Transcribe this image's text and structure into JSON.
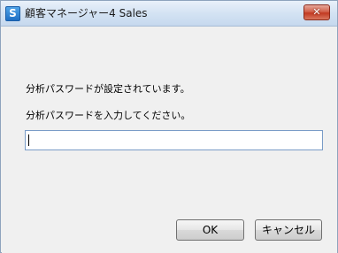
{
  "window": {
    "title": "顧客マネージャー4 Sales",
    "app_icon": "S",
    "close_icon": "close-icon"
  },
  "dialog": {
    "message_set": "分析パスワードが設定されています。",
    "message_prompt": "分析パスワードを入力してください。",
    "password_value": ""
  },
  "buttons": {
    "ok_label": "OK",
    "cancel_label": "キャンセル"
  },
  "colors": {
    "close_button": "#c23a22",
    "input_border": "#7a9cc7"
  }
}
